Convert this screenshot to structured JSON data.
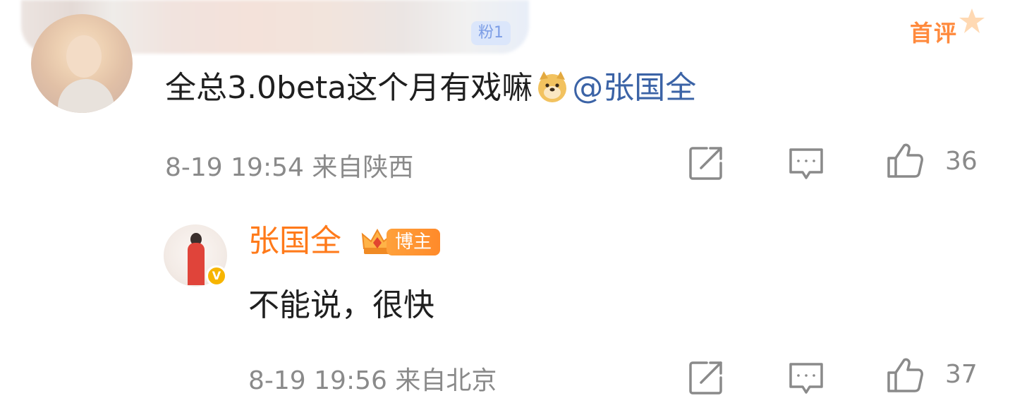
{
  "top_comment": {
    "redacted_badge": "粉1",
    "first_comment_badge": "首评",
    "text_prefix": "全总3.0beta这个月有戏嘛",
    "emoji_icon": "doge-emoji-icon",
    "mention": "@张国全",
    "date": "8-19",
    "time": "19:54",
    "location": "来自陕西",
    "likes": "36"
  },
  "reply": {
    "author": "张国全",
    "author_badge": "博主",
    "text": "不能说，很快",
    "date": "8-19",
    "time": "19:56",
    "location": "来自北京",
    "likes": "37"
  },
  "icons": {
    "share": "share-icon",
    "comment": "comment-icon",
    "like": "like-icon",
    "verified": "verified-icon",
    "crown": "crown-icon"
  },
  "colors": {
    "author_name": "#ff7a1a",
    "mention": "#3b63a6",
    "meta_text": "#8a8a8a",
    "first_badge": "#ff8a3d"
  }
}
